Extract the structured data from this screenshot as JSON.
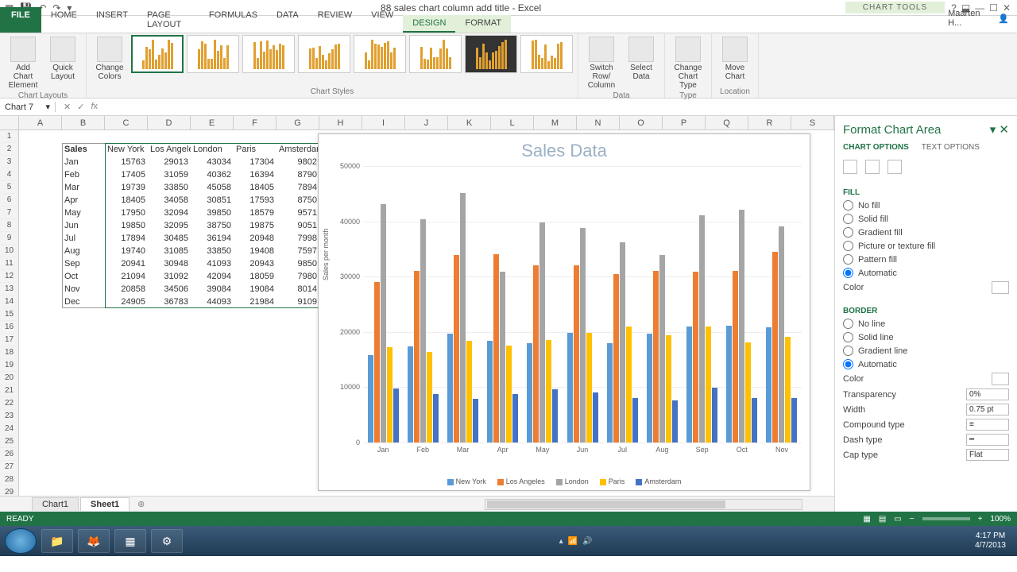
{
  "app_title": "88 sales chart column add title - Excel",
  "chart_tools": "CHART TOOLS",
  "win_user": "Maarten H...",
  "tabs": [
    "FILE",
    "HOME",
    "INSERT",
    "PAGE LAYOUT",
    "FORMULAS",
    "DATA",
    "REVIEW",
    "VIEW"
  ],
  "ctx_tabs": [
    "DESIGN",
    "FORMAT"
  ],
  "ribbon": {
    "layouts_label": "Chart Layouts",
    "styles_label": "Chart Styles",
    "data_label": "Data",
    "type_label": "Type",
    "loc_label": "Location",
    "add_chart_element": "Add Chart Element",
    "quick_layout": "Quick Layout",
    "change_colors": "Change Colors",
    "switch_row": "Switch Row/ Column",
    "select_data": "Select Data",
    "change_type": "Change Chart Type",
    "move_chart": "Move Chart"
  },
  "namebox": "Chart 7",
  "columns": [
    "A",
    "B",
    "C",
    "D",
    "E",
    "F",
    "G",
    "H",
    "I",
    "J",
    "K",
    "L",
    "M",
    "N",
    "O",
    "P",
    "Q",
    "R",
    "S"
  ],
  "row_count": 30,
  "sales_label": "Sales",
  "cities": [
    "New York",
    "Los Angeles",
    "London",
    "Paris",
    "Amsterdam"
  ],
  "months": [
    "Jan",
    "Feb",
    "Mar",
    "Apr",
    "May",
    "Jun",
    "Jul",
    "Aug",
    "Sep",
    "Oct",
    "Nov",
    "Dec"
  ],
  "data": [
    [
      15763,
      29013,
      43034,
      17304,
      9802
    ],
    [
      17405,
      31059,
      40362,
      16394,
      8790
    ],
    [
      19739,
      33850,
      45058,
      18405,
      7894
    ],
    [
      18405,
      34058,
      30851,
      17593,
      8750
    ],
    [
      17950,
      32094,
      39850,
      18579,
      9571
    ],
    [
      19850,
      32095,
      38750,
      19875,
      9051
    ],
    [
      17894,
      30485,
      36194,
      20948,
      7998
    ],
    [
      19740,
      31085,
      33850,
      19408,
      7597
    ],
    [
      20941,
      30948,
      41093,
      20943,
      9850
    ],
    [
      21094,
      31092,
      42094,
      18059,
      7980
    ],
    [
      20858,
      34506,
      39084,
      19084,
      8014
    ],
    [
      24905,
      36783,
      44093,
      21984,
      9109
    ]
  ],
  "chart_data": {
    "type": "bar",
    "title": "Sales Data",
    "ylabel": "Sales per month",
    "categories": [
      "Jan",
      "Feb",
      "Mar",
      "Apr",
      "May",
      "Jun",
      "Jul",
      "Aug",
      "Sep",
      "Oct",
      "Nov"
    ],
    "series": [
      {
        "name": "New York",
        "color": "#5b9bd5",
        "values": [
          15763,
          17405,
          19739,
          18405,
          17950,
          19850,
          17894,
          19740,
          20941,
          21094,
          20858
        ]
      },
      {
        "name": "Los Angeles",
        "color": "#ed7d31",
        "values": [
          29013,
          31059,
          33850,
          34058,
          32094,
          32095,
          30485,
          31085,
          30948,
          31092,
          34506
        ]
      },
      {
        "name": "London",
        "color": "#a5a5a5",
        "values": [
          43034,
          40362,
          45058,
          30851,
          39850,
          38750,
          36194,
          33850,
          41093,
          42094,
          39084
        ]
      },
      {
        "name": "Paris",
        "color": "#ffc000",
        "values": [
          17304,
          16394,
          18405,
          17593,
          18579,
          19875,
          20948,
          19408,
          20943,
          18059,
          19084
        ]
      },
      {
        "name": "Amsterdam",
        "color": "#4472c4",
        "values": [
          9802,
          8790,
          7894,
          8750,
          9571,
          9051,
          7998,
          7597,
          9850,
          7980,
          8014
        ]
      }
    ],
    "yticks": [
      0,
      10000,
      20000,
      30000,
      40000,
      50000
    ],
    "ylim": [
      0,
      50000
    ]
  },
  "sidepane": {
    "title": "Format Chart Area",
    "tab1": "CHART OPTIONS",
    "tab2": "TEXT OPTIONS",
    "fill": "FILL",
    "border": "BORDER",
    "nofill": "No fill",
    "solidfill": "Solid fill",
    "gradfill": "Gradient fill",
    "picfill": "Picture or texture fill",
    "patfill": "Pattern fill",
    "auto": "Automatic",
    "color": "Color",
    "noline": "No line",
    "solidline": "Solid line",
    "gradline": "Gradient line",
    "transparency": "Transparency",
    "transp_val": "0%",
    "width": "Width",
    "width_val": "0.75 pt",
    "compound": "Compound type",
    "dash": "Dash type",
    "cap": "Cap type",
    "cap_val": "Flat"
  },
  "sheet_tabs": [
    "Chart1",
    "Sheet1"
  ],
  "status_ready": "READY",
  "zoom": "100%",
  "clock_time": "4:17 PM",
  "clock_date": "4/7/2013"
}
